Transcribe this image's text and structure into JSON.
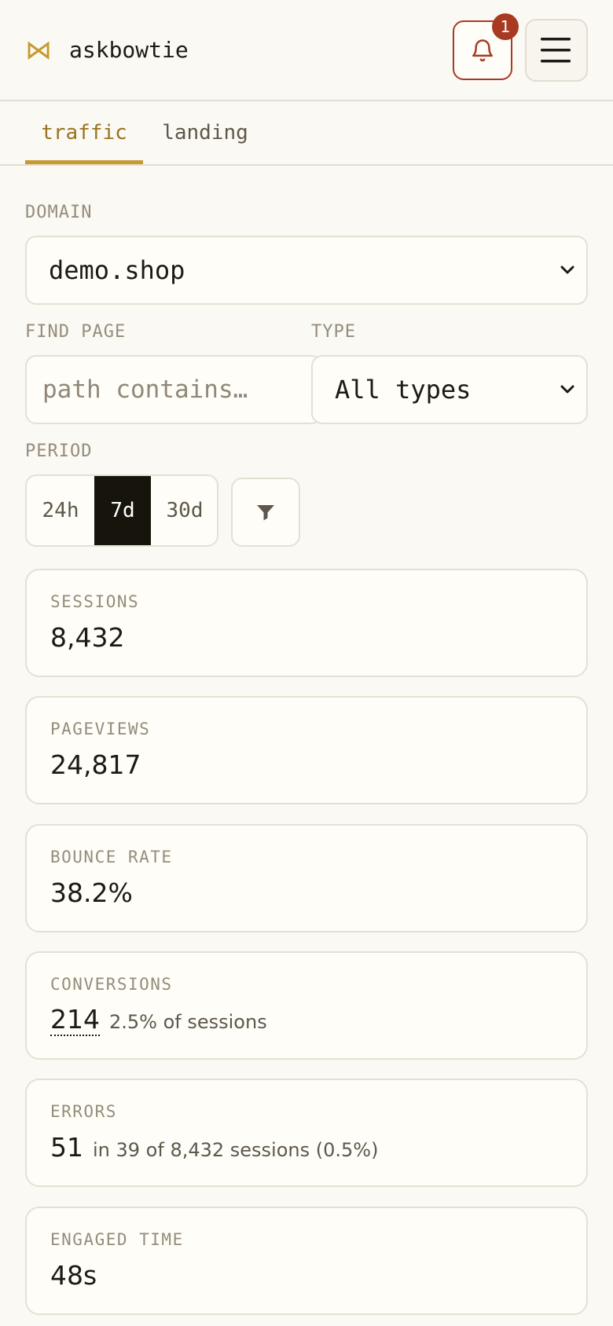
{
  "app": {
    "brand": "askbowtie",
    "notification_count": "1"
  },
  "tabs": [
    {
      "label": "traffic",
      "active": true
    },
    {
      "label": "landing",
      "active": false
    }
  ],
  "filters": {
    "domain_label": "DOMAIN",
    "domain_value": "demo.shop",
    "find_page_label": "FIND PAGE",
    "find_page_placeholder": "path contains…",
    "type_label": "TYPE",
    "type_value": "All types",
    "period_label": "PERIOD",
    "period_options": [
      "24h",
      "7d",
      "30d"
    ],
    "period_selected": "7d"
  },
  "metrics": [
    {
      "label": "SESSIONS",
      "value": "8,432",
      "sub": ""
    },
    {
      "label": "PAGEVIEWS",
      "value": "24,817",
      "sub": ""
    },
    {
      "label": "BOUNCE RATE",
      "value": "38.2%",
      "sub": ""
    },
    {
      "label": "CONVERSIONS",
      "value": "214",
      "sub": "2.5% of sessions"
    },
    {
      "label": "ERRORS",
      "value": "51",
      "sub": "in 39 of 8,432 sessions (0.5%)"
    },
    {
      "label": "ENGAGED TIME",
      "value": "48s",
      "sub": ""
    }
  ],
  "colors": {
    "accent": "#c69a2e",
    "alert": "#a83a22",
    "background": "#fbf9f4",
    "selected": "#17140c"
  }
}
